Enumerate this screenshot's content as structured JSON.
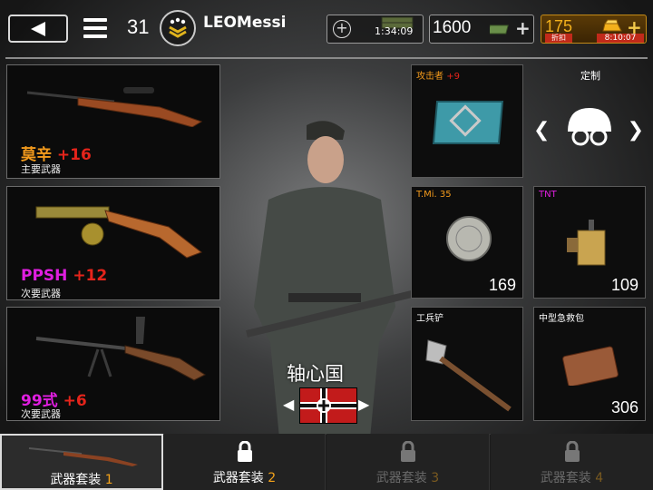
{
  "header": {
    "level": "31",
    "username": "LEOMessi",
    "timer_resource": "1:34:09",
    "money": "1600",
    "gold": "175",
    "gold_discount_label": "折扣",
    "gold_timer": "8:10:07"
  },
  "weapons": [
    {
      "name": "莫辛",
      "bonus": "+16",
      "slot": "主要武器",
      "name_color": "#f39a1c"
    },
    {
      "name": "PPSH",
      "bonus": "+12",
      "slot": "次要武器",
      "name_color": "#e01ee0"
    },
    {
      "name": "99式",
      "bonus": "+6",
      "slot": "次要武器",
      "name_color": "#e01ee0"
    }
  ],
  "panels": {
    "medal": {
      "title": "攻击者",
      "bonus": "+9"
    },
    "custom": {
      "title": "定制"
    },
    "mine": {
      "title": "T.Mi. 35",
      "count": "169"
    },
    "tnt": {
      "title": "TNT",
      "count": "109"
    },
    "shovel": {
      "title": "工兵铲"
    },
    "medkit": {
      "title": "中型急救包",
      "count": "306"
    }
  },
  "faction": {
    "name": "轴心国"
  },
  "loadouts": [
    {
      "label": "武器套装",
      "num": "1",
      "state": "active"
    },
    {
      "label": "武器套装",
      "num": "2",
      "state": "locked-available"
    },
    {
      "label": "武器套装",
      "num": "3",
      "state": "locked"
    },
    {
      "label": "武器套装",
      "num": "4",
      "state": "locked"
    }
  ],
  "colors": {
    "bonus_red": "#e5241b",
    "gold": "#f3b01c",
    "accent_orange": "#f3a21a",
    "tnt_magenta": "#e01ee0"
  }
}
